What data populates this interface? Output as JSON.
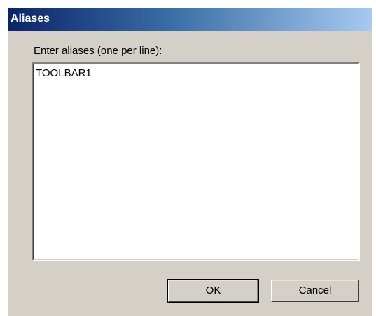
{
  "dialog": {
    "title": "Aliases",
    "prompt_label": "Enter aliases (one per line):",
    "aliases_text": "TOOLBAR1",
    "ok_label": "OK",
    "cancel_label": "Cancel"
  },
  "colors": {
    "dialog_background": "#d4d0c8",
    "titlebar_start": "#0a246a",
    "titlebar_end": "#a6caf0",
    "title_text": "#ffffff"
  }
}
